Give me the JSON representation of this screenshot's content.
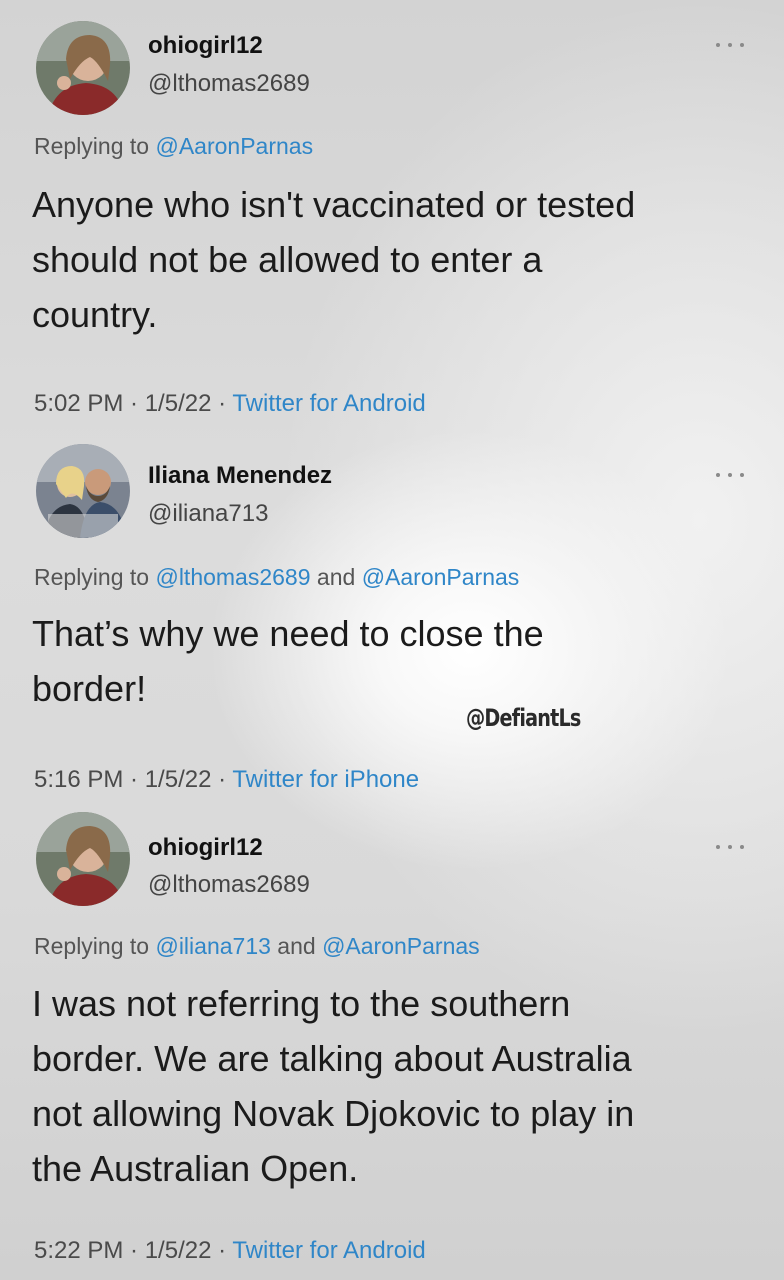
{
  "tweets": [
    {
      "display_name": "ohiogirl12",
      "handle": "@lthomas2689",
      "replying_prefix": "Replying to ",
      "replying_mentions": [
        "@AaronParnas"
      ],
      "replying_joiner": "",
      "text": "Anyone who isn't vaccinated or tested\nshould not be allowed to enter a\ncountry.",
      "time_date": "5:02 PM · 1/5/22 · ",
      "source": "Twitter for Android",
      "avatar_icon": "user-avatar-woman"
    },
    {
      "display_name": "Iliana Menendez",
      "handle": "@iliana713",
      "replying_prefix": "Replying to ",
      "replying_mentions": [
        "@lthomas2689",
        "@AaronParnas"
      ],
      "replying_joiner": " and ",
      "text": "That’s why we need to close the\nborder!",
      "time_date": "5:16 PM · 1/5/22 · ",
      "source": "Twitter for iPhone",
      "avatar_icon": "user-avatar-couple"
    },
    {
      "display_name": "ohiogirl12",
      "handle": "@lthomas2689",
      "replying_prefix": "Replying to ",
      "replying_mentions": [
        "@iliana713",
        "@AaronParnas"
      ],
      "replying_joiner": " and ",
      "text": "I was not referring to the southern\nborder. We are talking about Australia\nnot allowing Novak Djokovic to play in\nthe Australian Open.",
      "time_date": "5:22 PM · 1/5/22 · ",
      "source": "Twitter for Android",
      "avatar_icon": "user-avatar-woman"
    }
  ],
  "watermark": "@DefiantLs",
  "colors": {
    "link": "#2f86c8",
    "text": "#1b1b1b",
    "secondary": "#4a4a4a",
    "background": "#d8d8d8"
  },
  "icons": {
    "more": "more-options-icon"
  }
}
